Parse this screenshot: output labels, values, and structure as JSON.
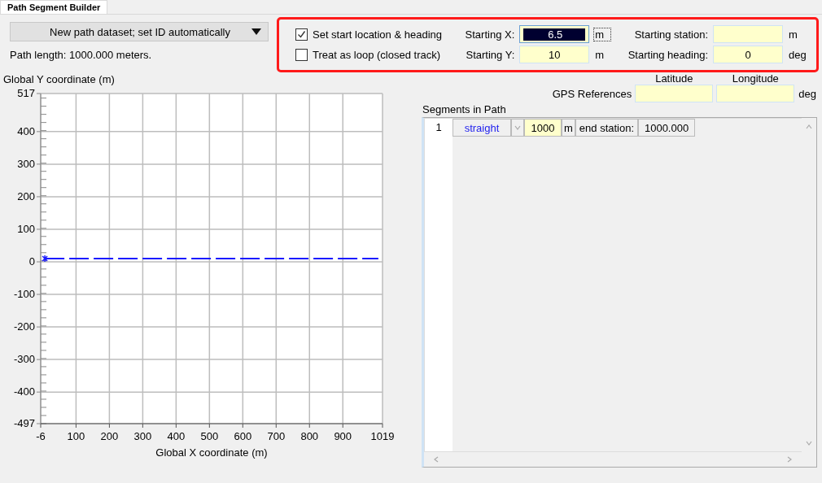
{
  "tab": {
    "label": "Path Segment Builder",
    "selected": true
  },
  "dataset_dropdown": {
    "value": "New path dataset; set ID automatically"
  },
  "path_length": "Path length: 1000.000 meters.",
  "options": [
    {
      "label": "Set start location & heading",
      "checked": true
    },
    {
      "label": "Treat as loop (closed track)",
      "checked": false
    }
  ],
  "start_fields": [
    {
      "label": "Starting X:",
      "value": "6.5",
      "unit": "m",
      "focused": true
    },
    {
      "label": "Starting station:",
      "unit": "m",
      "focused": false
    },
    {
      "label": "Starting Y:",
      "value": "10",
      "unit": "m",
      "focused": false
    },
    {
      "label": "Starting heading:",
      "value": "0",
      "unit": "deg",
      "focused": false
    }
  ],
  "gps": {
    "label": "GPS References",
    "columns": [
      "Latitude",
      "Longitude"
    ],
    "unit": "deg"
  },
  "segments": {
    "title": "Segments in Path",
    "rows": [
      {
        "index": "1",
        "type": "straight",
        "length": "1000",
        "unit": "m",
        "end_label": "end station:",
        "end_station": "1000.000"
      }
    ]
  },
  "plot": {
    "chart_data": {
      "type": "line",
      "xlabel": "Global X coordinate (m)",
      "ylabel": "Global Y coordinate (m)",
      "x": [
        6.5,
        1006.5
      ],
      "series": [
        {
          "color": "#1a1aff",
          "line_style": "dashed",
          "values": [
            10,
            10
          ]
        }
      ],
      "grid": true,
      "xlim": [
        -6,
        1019
      ],
      "ylim": [
        -497,
        517
      ],
      "xticks": [
        -6,
        100,
        200,
        300,
        400,
        500,
        600,
        700,
        800,
        900,
        1019
      ],
      "yticks": [
        -497,
        -400,
        -300,
        -200,
        -100,
        0,
        100,
        200,
        300,
        400,
        517
      ]
    }
  }
}
